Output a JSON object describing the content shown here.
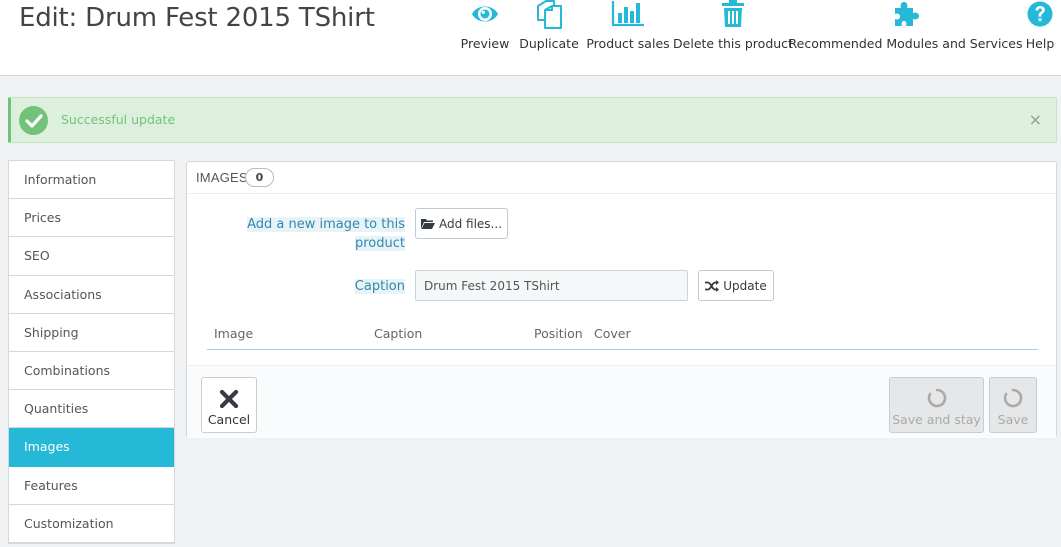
{
  "header": {
    "title": "Edit: Drum Fest 2015 TShirt",
    "toolbar": [
      {
        "label": "Preview",
        "icon": "eye-icon"
      },
      {
        "label": "Duplicate",
        "icon": "copy-icon"
      },
      {
        "label": "Product sales",
        "icon": "bar-chart-icon"
      },
      {
        "label": "Delete this product",
        "icon": "trash-icon"
      },
      {
        "label": "Recommended Modules and Services",
        "icon": "puzzle-icon"
      },
      {
        "label": "Help",
        "icon": "help-icon"
      }
    ],
    "accent_color": "#25b9d7"
  },
  "alert": {
    "message": "Successful update",
    "close": "×",
    "color": "#72c279"
  },
  "sidebar": {
    "tabs": [
      {
        "label": "Information"
      },
      {
        "label": "Prices"
      },
      {
        "label": "SEO"
      },
      {
        "label": "Associations"
      },
      {
        "label": "Shipping"
      },
      {
        "label": "Combinations"
      },
      {
        "label": "Quantities"
      },
      {
        "label": "Images",
        "active": true
      },
      {
        "label": "Features"
      },
      {
        "label": "Customization"
      }
    ]
  },
  "panel": {
    "heading": "IMAGES",
    "count": "0",
    "add_image_label_line1": "Add a new image to this",
    "add_image_label_line2": "product",
    "add_files_button": "Add files...",
    "caption_label": "Caption",
    "caption_value": "Drum Fest 2015 TShirt",
    "update_button": "Update",
    "table_headers": [
      "Image",
      "Caption",
      "Position",
      "Cover"
    ]
  },
  "footer": {
    "cancel": "Cancel",
    "save_and_stay": "Save and stay",
    "save": "Save"
  }
}
